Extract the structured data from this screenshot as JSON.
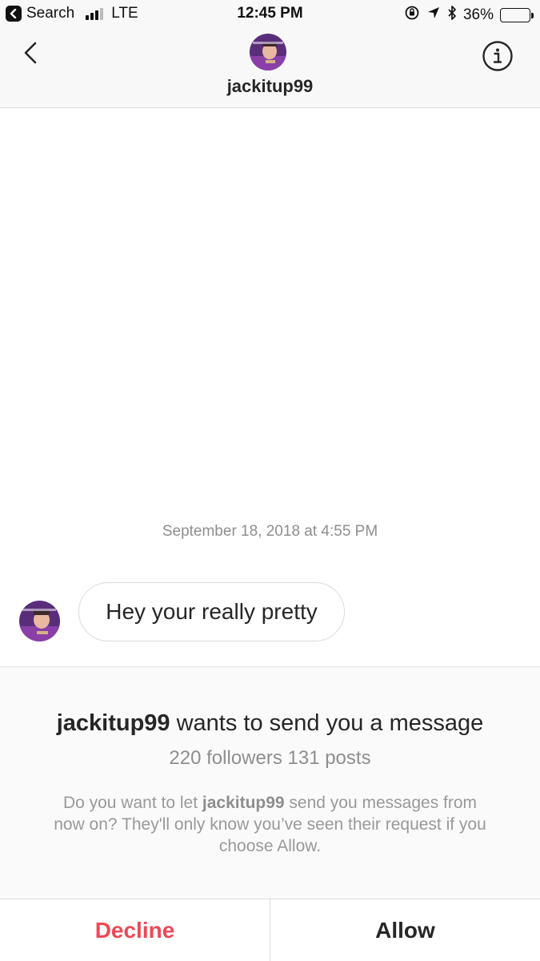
{
  "status_bar": {
    "back_label": "Search",
    "carrier": "LTE",
    "time": "12:45 PM",
    "battery_percent": "36%",
    "battery_level": 0.36,
    "icons": [
      "back-arrow-icon",
      "signal-bars-icon",
      "orientation-lock-icon",
      "location-arrow-icon",
      "bluetooth-icon",
      "battery-icon"
    ]
  },
  "header": {
    "username": "jackitup99",
    "icons": [
      "chevron-left-icon",
      "avatar",
      "info-icon"
    ]
  },
  "thread": {
    "timestamp": "September 18, 2018 at 4:55 PM",
    "messages": [
      {
        "text": "Hey your really pretty"
      }
    ]
  },
  "request": {
    "username": "jackitup99",
    "title_suffix": " wants to send you a message",
    "stats": "220 followers 131 posts",
    "body_prefix": "Do you want to let ",
    "body_username": "jackitup99",
    "body_suffix": " send you messages from now on? They'll only know you’ve seen their request if you choose Allow."
  },
  "actions": {
    "decline_label": "Decline",
    "allow_label": "Allow"
  },
  "colors": {
    "decline": "#ed4956",
    "text_primary": "#262626",
    "text_secondary": "#8e8e8e",
    "avatar_purple": "#6a3a8c"
  }
}
